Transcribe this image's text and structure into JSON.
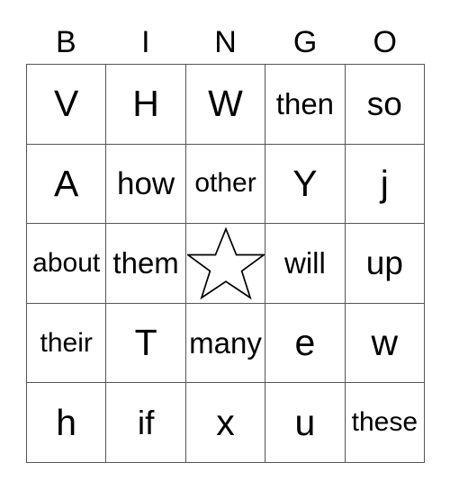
{
  "card": {
    "headers": [
      "B",
      "I",
      "N",
      "G",
      "O"
    ],
    "rows": [
      [
        {
          "text": "V"
        },
        {
          "text": "H"
        },
        {
          "text": "W"
        },
        {
          "text": "then"
        },
        {
          "text": "so"
        }
      ],
      [
        {
          "text": "A"
        },
        {
          "text": "how"
        },
        {
          "text": "other"
        },
        {
          "text": "Y"
        },
        {
          "text": "j"
        }
      ],
      [
        {
          "text": "about"
        },
        {
          "text": "them"
        },
        {
          "text": "",
          "free": true,
          "icon": "star-icon"
        },
        {
          "text": "will"
        },
        {
          "text": "up"
        }
      ],
      [
        {
          "text": "their"
        },
        {
          "text": "T"
        },
        {
          "text": "many"
        },
        {
          "text": "e"
        },
        {
          "text": "w"
        }
      ],
      [
        {
          "text": "h"
        },
        {
          "text": "if"
        },
        {
          "text": "x"
        },
        {
          "text": "u"
        },
        {
          "text": "these"
        }
      ]
    ],
    "colors": {
      "text": "#000000",
      "border": "#555555",
      "background": "#ffffff",
      "star_stroke": "#000000",
      "star_fill": "#ffffff"
    }
  }
}
